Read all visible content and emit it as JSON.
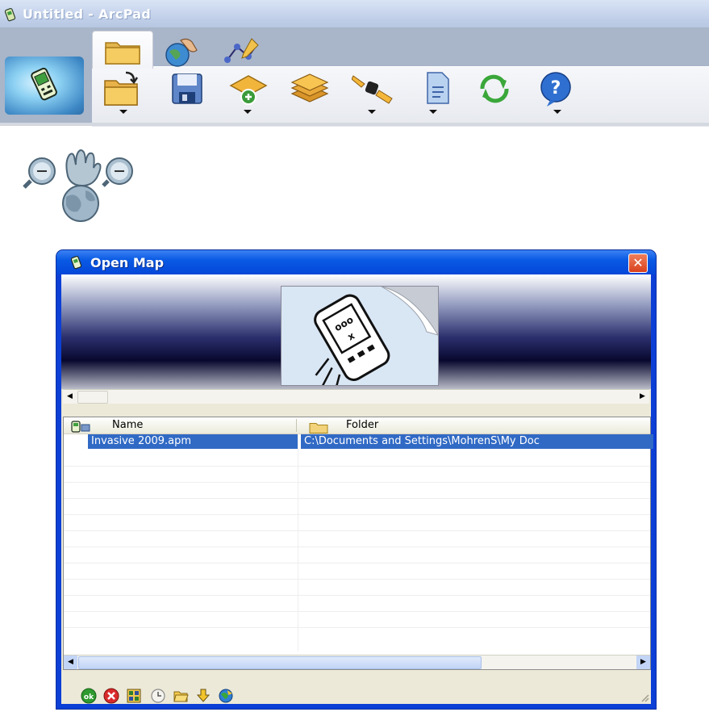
{
  "app": {
    "title": "Untitled - ArcPad"
  },
  "toolbar": {
    "tabs": [
      {
        "icon": "folder-tab-icon"
      },
      {
        "icon": "globe-hand-tab-icon"
      },
      {
        "icon": "edit-vertices-tab-icon"
      }
    ],
    "tools": [
      {
        "icon": "open-map-icon",
        "has_dropdown": true
      },
      {
        "icon": "save-icon",
        "has_dropdown": false
      },
      {
        "icon": "add-layer-icon",
        "has_dropdown": true
      },
      {
        "icon": "layers-icon",
        "has_dropdown": false
      },
      {
        "icon": "gps-icon",
        "has_dropdown": true
      },
      {
        "icon": "document-icon",
        "has_dropdown": true
      },
      {
        "icon": "refresh-icon",
        "has_dropdown": false
      },
      {
        "icon": "help-icon",
        "has_dropdown": true
      }
    ]
  },
  "dialog": {
    "title": "Open Map",
    "close_label": "✕",
    "columns": {
      "name": "Name",
      "folder": "Folder"
    },
    "rows": [
      {
        "name": "Invasive 2009.apm",
        "folder": "C:\\Documents and Settings\\MohrenS\\My Doc"
      }
    ],
    "bottom_tools": [
      "ok-icon",
      "cancel-icon",
      "grid-icon",
      "clock-icon",
      "open-folder-icon",
      "download-icon",
      "globe-icon"
    ]
  },
  "colors": {
    "dialog_frame": "#0c3fd6",
    "selection": "#316ac5"
  }
}
